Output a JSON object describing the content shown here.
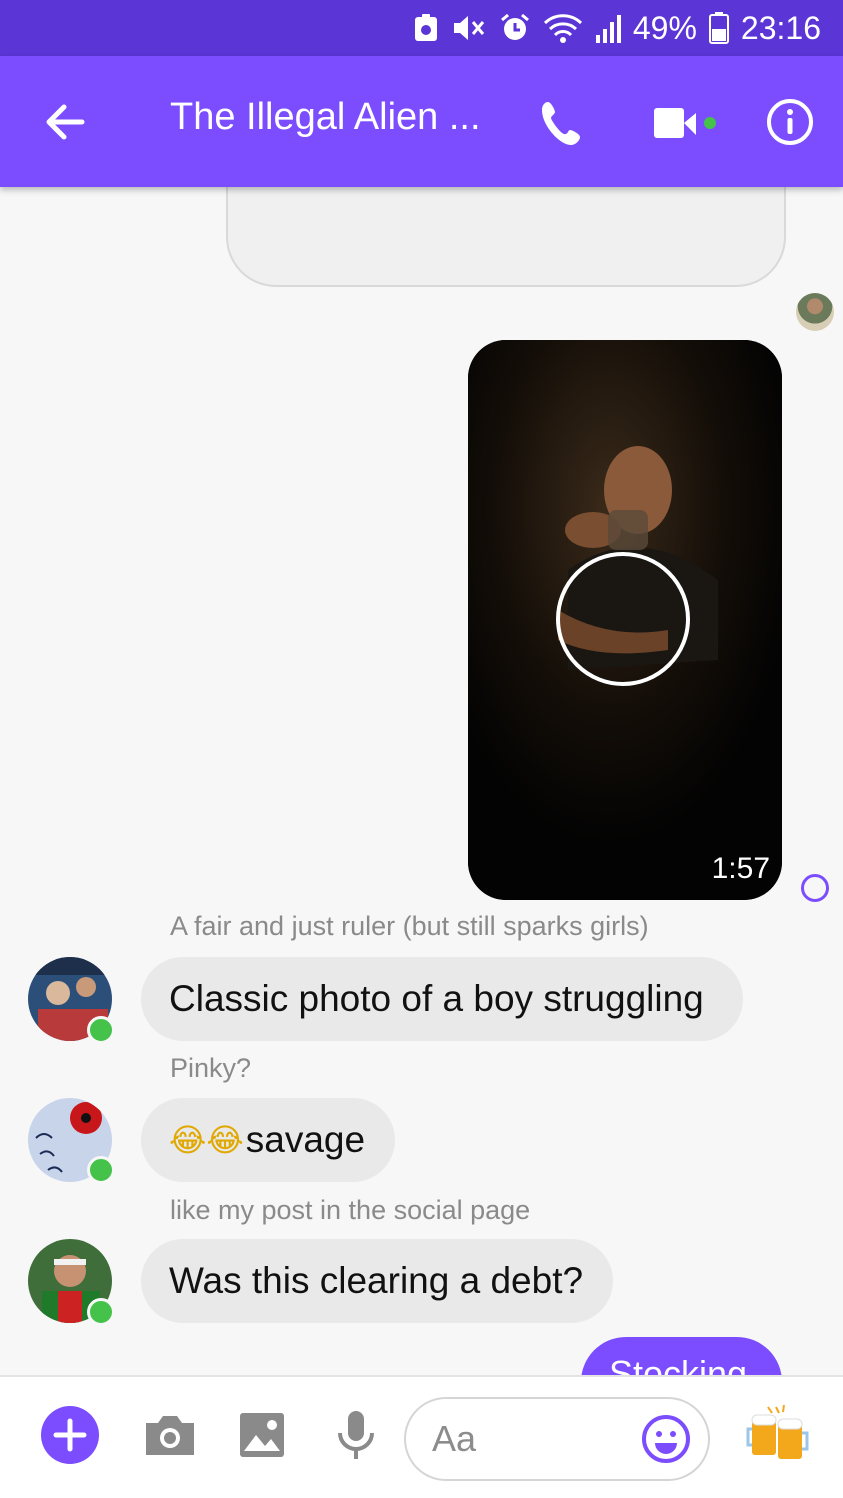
{
  "status_bar": {
    "battery": "49%",
    "time": "23:16",
    "icons": [
      "recycle-icon",
      "mute-icon",
      "alarm-icon",
      "wifi-icon",
      "signal-icon",
      "battery-icon"
    ]
  },
  "header": {
    "title": "The Illegal Alien ...",
    "icons": [
      "back-arrow-icon",
      "phone-icon",
      "video-camera-icon",
      "info-icon"
    ],
    "video_active_color": "#44c24a"
  },
  "colors": {
    "accent": "#7c4dff",
    "status_bar": "#5b35d5",
    "incoming_bubble": "#e9e9e9",
    "online": "#44c24a"
  },
  "messages": {
    "video": {
      "duration": "1:57"
    },
    "items": [
      {
        "reply_label": "A fair and just ruler (but still sparks girls)",
        "text": "Classic photo of a boy struggling"
      },
      {
        "reply_label": "Pinky?",
        "text": "savage",
        "emoji_prefix": "😂😂"
      },
      {
        "reply_label": "like my post in the social page",
        "text": "Was this clearing a debt?"
      }
    ],
    "outgoing_partial": "Stocking"
  },
  "composer": {
    "placeholder": "Aa",
    "icons": [
      "add-icon",
      "camera-icon",
      "image-icon",
      "microphone-icon",
      "emoji-icon",
      "beer-icon"
    ]
  }
}
